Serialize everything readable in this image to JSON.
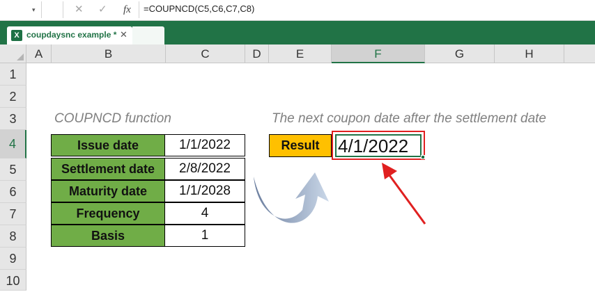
{
  "formula_bar": {
    "name_box_arrow": "▾",
    "cancel_symbol": "✕",
    "enter_symbol": "✓",
    "fx_symbol": "fx",
    "formula": "=COUPNCD(C5,C6,C7,C8)"
  },
  "workbook_tab": {
    "icon_letter": "X",
    "label": "coupdaysnc example *",
    "close_symbol": "✕"
  },
  "columns": [
    "A",
    "B",
    "C",
    "D",
    "E",
    "F",
    "G",
    "H"
  ],
  "selected_column": "F",
  "rows": [
    "1",
    "2",
    "3",
    "4",
    "5",
    "6",
    "7",
    "8",
    "9",
    "10"
  ],
  "selected_row": "4",
  "sheet": {
    "table_caption": "COUPNCD function",
    "result_caption": "The next coupon date after the settlement date",
    "table": [
      {
        "label": "Issue date",
        "value": "1/1/2022"
      },
      {
        "label": "Settlement date",
        "value": "2/8/2022"
      },
      {
        "label": "Maturity date",
        "value": "1/1/2028"
      },
      {
        "label": "Frequency",
        "value": "4"
      },
      {
        "label": "Basis",
        "value": "1"
      }
    ],
    "result_label": "Result",
    "result_value": "4/1/2022"
  },
  "colors": {
    "excel_green": "#217346",
    "label_fill": "#70ad47",
    "result_label_fill": "#ffc000",
    "highlight_red": "#e02020",
    "arrow_blue": "#8fa8c8"
  }
}
